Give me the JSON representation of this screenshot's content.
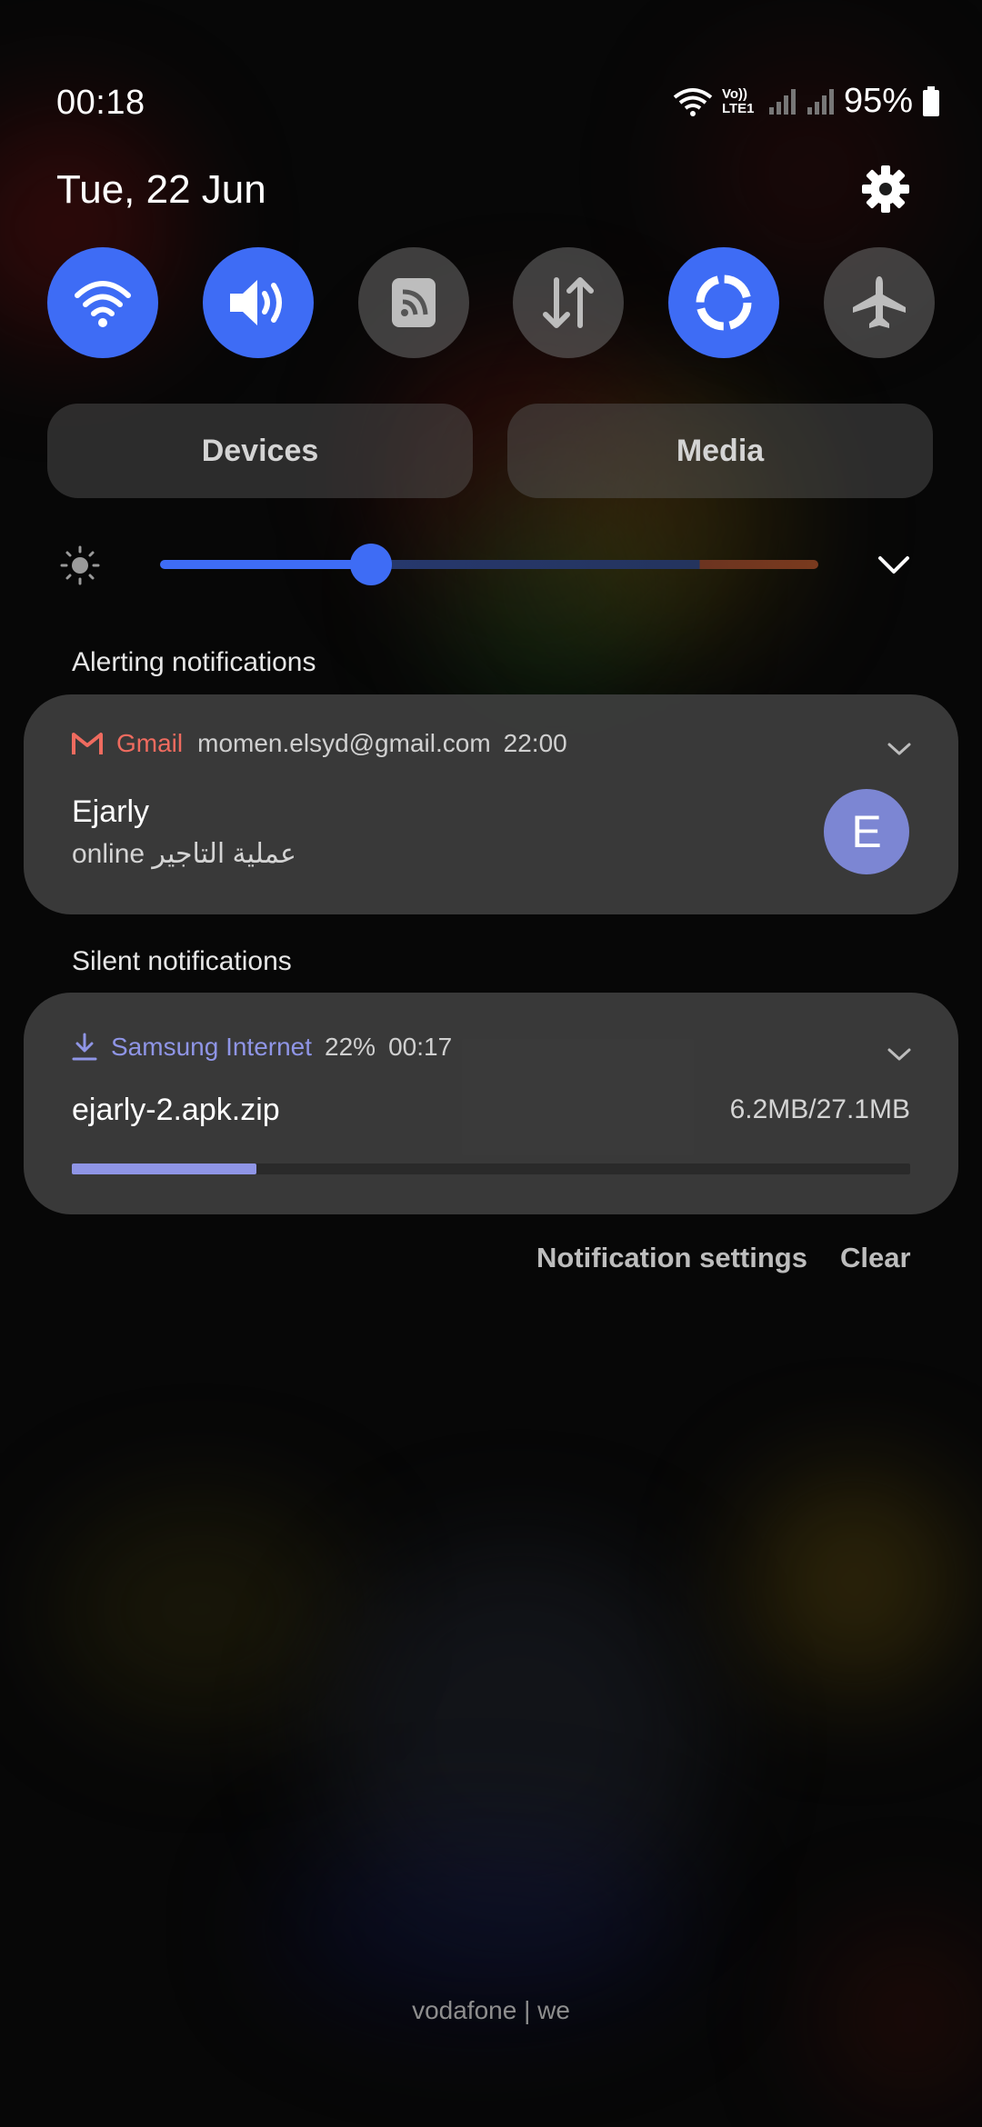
{
  "status_bar": {
    "time": "00:18",
    "volte_label": "Vo)) LTE1",
    "battery_percent": "95%",
    "icons": [
      "wifi-icon",
      "volte-icon",
      "signal-icon",
      "signal-icon",
      "battery-icon"
    ]
  },
  "panel": {
    "date": "Tue, 22 Jun",
    "settings_icon": "gear-icon"
  },
  "quick_settings": [
    {
      "icon": "wifi-icon",
      "state": "on"
    },
    {
      "icon": "sound-icon",
      "state": "on"
    },
    {
      "icon": "nfc-icon",
      "state": "off"
    },
    {
      "icon": "mobile-data-icon",
      "state": "off"
    },
    {
      "icon": "power-saving-icon",
      "state": "on"
    },
    {
      "icon": "airplane-mode-icon",
      "state": "off"
    }
  ],
  "buttons": {
    "devices": "Devices",
    "media": "Media"
  },
  "brightness": {
    "level": 0.32,
    "icon": "sun-icon",
    "expand_icon": "chevron-down-icon"
  },
  "sections": {
    "alerting": "Alerting notifications",
    "silent": "Silent notifications"
  },
  "gmail_notification": {
    "app": "Gmail",
    "account": "momen.elsyd@gmail.com",
    "time": "22:00",
    "title": "Ejarly",
    "body": "online عملية التاجير",
    "avatar_letter": "E",
    "app_icon": "gmail-icon",
    "accent": "#ef6b5f"
  },
  "download_notification": {
    "app": "Samsung Internet",
    "percent": "22%",
    "time": "00:17",
    "file": "ejarly-2.apk.zip",
    "size": "6.2MB/27.1MB",
    "progress": 0.22,
    "app_icon": "download-icon",
    "accent": "#8f95e6"
  },
  "actions": {
    "notification_settings": "Notification settings",
    "clear": "Clear"
  },
  "carrier": "vodafone | we",
  "colors": {
    "toggle_on": "#3e6cf5",
    "avatar": "#7c86d3"
  }
}
